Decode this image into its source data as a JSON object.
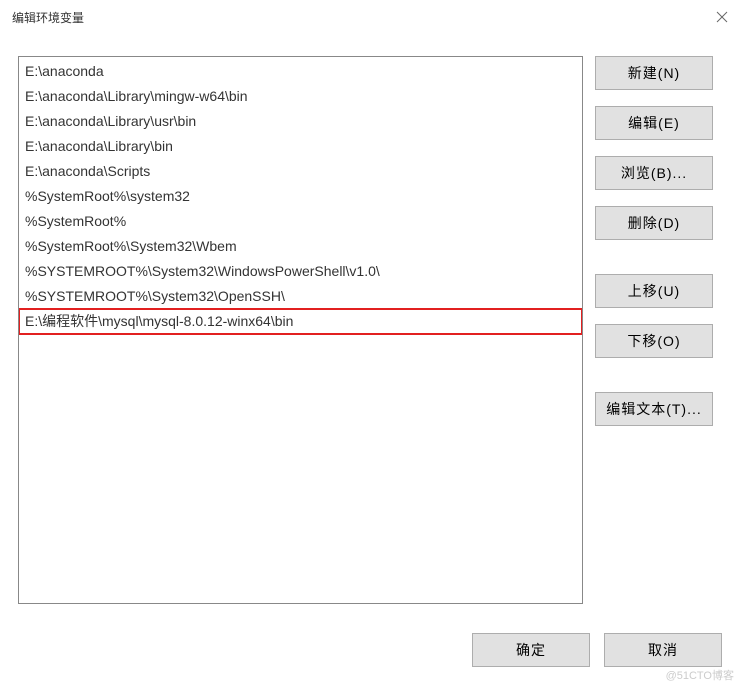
{
  "title": "编辑环境变量",
  "list_items": [
    {
      "text": "E:\\anaconda",
      "hl": false
    },
    {
      "text": "E:\\anaconda\\Library\\mingw-w64\\bin",
      "hl": false
    },
    {
      "text": "E:\\anaconda\\Library\\usr\\bin",
      "hl": false
    },
    {
      "text": "E:\\anaconda\\Library\\bin",
      "hl": false
    },
    {
      "text": "E:\\anaconda\\Scripts",
      "hl": false
    },
    {
      "text": "%SystemRoot%\\system32",
      "hl": false
    },
    {
      "text": "%SystemRoot%",
      "hl": false
    },
    {
      "text": "%SystemRoot%\\System32\\Wbem",
      "hl": false
    },
    {
      "text": "%SYSTEMROOT%\\System32\\WindowsPowerShell\\v1.0\\",
      "hl": false
    },
    {
      "text": "%SYSTEMROOT%\\System32\\OpenSSH\\",
      "hl": false
    },
    {
      "text": "E:\\编程软件\\mysql\\mysql-8.0.12-winx64\\bin",
      "hl": true
    }
  ],
  "buttons": {
    "new": "新建(N)",
    "edit": "编辑(E)",
    "browse": "浏览(B)...",
    "delete": "删除(D)",
    "up": "上移(U)",
    "down": "下移(O)",
    "edit_text": "编辑文本(T)...",
    "ok": "确定",
    "cancel": "取消"
  },
  "watermark": "@51CTO博客"
}
